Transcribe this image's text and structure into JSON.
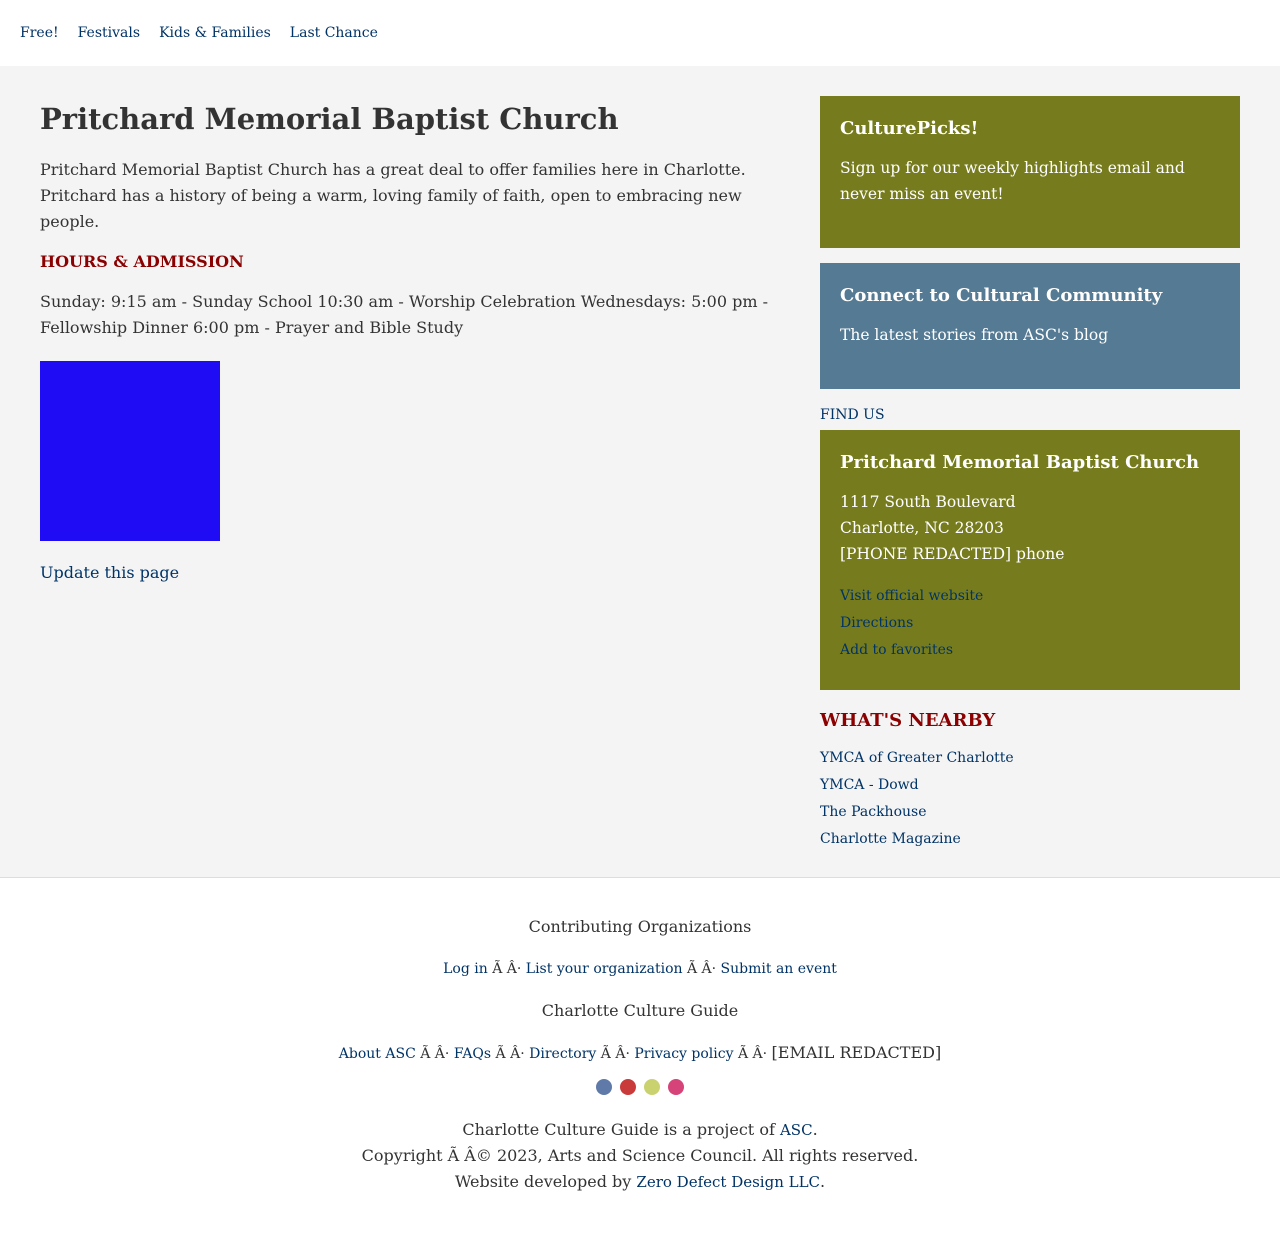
{
  "nav": {
    "items": [
      "Free!",
      "Festivals",
      "Kids & Families",
      "Last Chance"
    ]
  },
  "main": {
    "title": "Pritchard Memorial Baptist Church",
    "intro": "Pritchard Memorial Baptist Church has a great deal to offer families here in Charlotte. Pritchard has a history of being a warm, loving family of faith, open to embracing new people.",
    "hours_heading": "HOURS & ADMISSION",
    "hours_text": "Sunday: 9:15 am - Sunday School 10:30 am - Worship Celebration Wednesdays: 5:00 pm - Fellowship Dinner 6:00 pm - Prayer and Bible Study",
    "image_color": "#1f0cf5",
    "update_link": "Update this page"
  },
  "sidebar": {
    "culturepicks": {
      "title": "CulturePicks!",
      "text": "Sign up for our weekly highlights email and never miss an event!"
    },
    "connect": {
      "title": "Connect to Cultural Community",
      "text": "The latest stories from ASC's blog"
    },
    "find_us_label": "FIND US",
    "location": {
      "name": "Pritchard Memorial Baptist Church",
      "street": "1117 South Boulevard",
      "city": "Charlotte, NC 28203",
      "phone": "[PHONE REDACTED] phone",
      "links": [
        "Visit official website",
        "Directions",
        "Add to favorites"
      ]
    },
    "nearby": {
      "heading": "WHAT'S NEARBY",
      "items": [
        "YMCA of Greater Charlotte",
        "YMCA - Dowd",
        "The Packhouse",
        "Charlotte Magazine"
      ]
    }
  },
  "footer": {
    "contrib_heading": "Contributing Organizations",
    "contrib_links": [
      "Log in",
      "List your organization",
      "Submit an event"
    ],
    "separator": " Ã    Â· ",
    "guide_heading": "Charlotte Culture Guide",
    "guide_links": [
      "About ASC",
      "FAQs",
      "Directory",
      "Privacy policy"
    ],
    "email": "[EMAIL REDACTED]",
    "social_colors": [
      "#5f7aa8",
      "#c93a3a",
      "#c9d26f",
      "#d64378"
    ],
    "project_text": "Charlotte Culture Guide is a project of",
    "project_link": "ASC",
    "copyright": "Copyright Ã    Â© 2023, Arts and Science Council. All rights reserved.",
    "developer_text": "Website developed by",
    "developer_link": "Zero Defect Design LLC"
  },
  "colors": {
    "olive": "#767c1e",
    "slate": "#557a93",
    "heading_red": "#8b0000",
    "link": "#003366"
  }
}
